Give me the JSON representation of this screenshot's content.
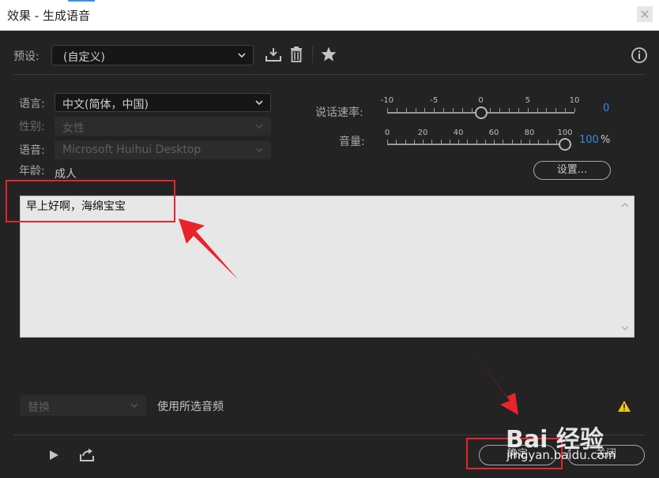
{
  "window": {
    "title": "效果 - 生成语音",
    "close_label": "×"
  },
  "preset": {
    "label": "预设:",
    "value": "(自定义)"
  },
  "voice": {
    "language_label": "语言:",
    "language_value": "中文(简体，中国)",
    "gender_label": "性别:",
    "gender_value": "女性",
    "voice_label": "语音:",
    "voice_value": "Microsoft Huihui Desktop",
    "age_label": "年龄:",
    "age_value": "成人"
  },
  "speech_rate": {
    "label": "说话速率:",
    "ticks": [
      "-10",
      "-5",
      "0",
      "5",
      "10"
    ],
    "value": "0",
    "min": -10,
    "max": 10,
    "current": 0
  },
  "volume": {
    "label": "音量:",
    "ticks": [
      "0",
      "20",
      "40",
      "60",
      "80",
      "100"
    ],
    "value": "100",
    "unit": "%",
    "min": 0,
    "max": 100,
    "current": 100
  },
  "settings_button": "设置...",
  "text_input": {
    "value": "早上好啊，海绵宝宝"
  },
  "replace": {
    "value": "替换",
    "label": "使用所选音频"
  },
  "footer": {
    "ok_label": "确定",
    "close_label": "关闭"
  },
  "watermark": {
    "brand": "Bai 经验",
    "url": "jingyan.baidu.com"
  },
  "colors": {
    "accent": "#2d8ceb",
    "annotation": "#e8232b",
    "warning": "#f5c518"
  }
}
